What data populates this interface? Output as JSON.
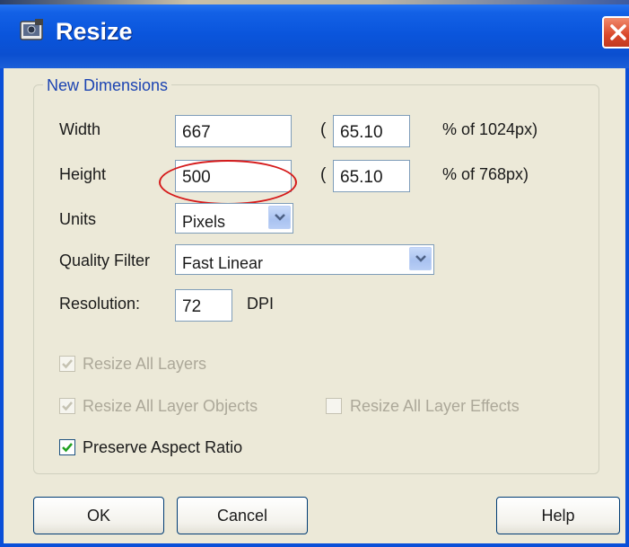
{
  "window": {
    "title": "Resize"
  },
  "group": {
    "title": "New Dimensions"
  },
  "width": {
    "label": "Width",
    "value": "667",
    "percent": "65.10",
    "suffix": "% of 1024px)"
  },
  "height": {
    "label": "Height",
    "value": "500",
    "percent": "65.10",
    "suffix": "% of 768px)"
  },
  "paren_open": "(",
  "units": {
    "label": "Units",
    "selected": "Pixels"
  },
  "quality": {
    "label": "Quality Filter",
    "selected": "Fast Linear"
  },
  "resolution": {
    "label": "Resolution:",
    "value": "72",
    "unit": "DPI"
  },
  "checkboxes": {
    "resize_all_layers": {
      "label": "Resize All Layers",
      "checked": true,
      "enabled": false
    },
    "resize_all_layer_objects": {
      "label": "Resize All Layer Objects",
      "checked": true,
      "enabled": false
    },
    "resize_all_layer_effects": {
      "label": "Resize All Layer Effects",
      "checked": false,
      "enabled": false
    },
    "preserve_aspect_ratio": {
      "label": "Preserve Aspect Ratio",
      "checked": true,
      "enabled": true
    }
  },
  "buttons": {
    "ok": "OK",
    "cancel": "Cancel",
    "help": "Help"
  },
  "annotation": {
    "color": "#d51a1a",
    "shape": "ellipse around height value"
  },
  "colors": {
    "titlebar": "#0a55dc",
    "dialog_bg": "#ece9d8",
    "group_title": "#1c44b2",
    "close": "#d9472a"
  }
}
